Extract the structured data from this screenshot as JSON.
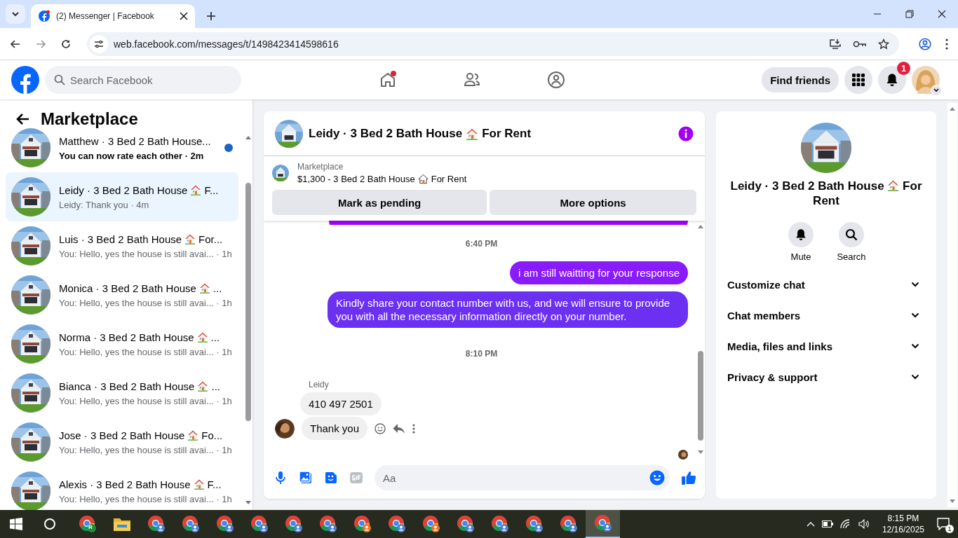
{
  "browser": {
    "tab_title": "(2) Messenger | Facebook",
    "url": "web.facebook.com/messages/t/1498423414598616"
  },
  "header": {
    "search_placeholder": "Search Facebook",
    "find_friends": "Find friends",
    "notification_count": "1"
  },
  "sidebar": {
    "title": "Marketplace",
    "conversations": [
      {
        "title": "Matthew · 3 Bed 2 Bath House...",
        "preview": "You can now rate each other · 2m",
        "unread": true,
        "selected": false
      },
      {
        "title": "Leidy · 3 Bed 2 Bath House",
        "title_end": "F...",
        "preview": "Leidy: Thank you · 4m",
        "unread": false,
        "selected": true
      },
      {
        "title": "Luis · 3 Bed 2 Bath House",
        "title_end": "For...",
        "preview": "You: Hello, yes the house is still avai... · 1h",
        "unread": false,
        "selected": false
      },
      {
        "title": "Monica · 3 Bed 2 Bath House",
        "title_end": "...",
        "preview": "You: Hello, yes the house is still avai... · 1h",
        "unread": false,
        "selected": false
      },
      {
        "title": "Norma · 3 Bed 2 Bath House",
        "title_end": "...",
        "preview": "You: Hello, yes the house is still avai... · 1h",
        "unread": false,
        "selected": false
      },
      {
        "title": "Bianca · 3 Bed 2 Bath House",
        "title_end": "...",
        "preview": "You: Hello, yes the house is still avai... · 1h",
        "unread": false,
        "selected": false
      },
      {
        "title": "Jose · 3 Bed 2 Bath House",
        "title_end": "Fo...",
        "preview": "You: Hello, yes the house is still avai... · 1h",
        "unread": false,
        "selected": false
      },
      {
        "title": "Alexis · 3 Bed 2 Bath House",
        "title_end": "F...",
        "preview": "You: Hello, yes the house is still avai... · 1h",
        "unread": false,
        "selected": false
      }
    ]
  },
  "chat": {
    "title": "Leidy · 3 Bed 2 Bath House",
    "title_end": "For Rent",
    "listing": {
      "label": "Marketplace",
      "title": "$1,300 - 3 Bed 2 Bath House",
      "title_end": "For Rent"
    },
    "actions": [
      "Mark as pending",
      "More options"
    ],
    "messages": [
      {
        "kind": "sent-cut"
      },
      {
        "kind": "time",
        "text": "6:40 PM"
      },
      {
        "kind": "sent",
        "text": "i am still waitting for your response"
      },
      {
        "kind": "sent",
        "text": "Kindly share your contact number with us, and we will ensure to provide you with all the necessary information directly on your number."
      },
      {
        "kind": "time",
        "text": "8:10 PM"
      },
      {
        "kind": "sender",
        "text": "Leidy"
      },
      {
        "kind": "received",
        "text": "410 497 2501"
      },
      {
        "kind": "received-last",
        "text": "Thank you"
      },
      {
        "kind": "seen"
      }
    ],
    "composer_placeholder": "Aa"
  },
  "details": {
    "title": "Leidy · 3 Bed 2 Bath House",
    "title_end": "For Rent",
    "actions": [
      {
        "kind": "mute",
        "label": "Mute"
      },
      {
        "kind": "search",
        "label": "Search"
      }
    ],
    "sections": [
      "Customize chat",
      "Chat members",
      "Media, files and links",
      "Privacy & support"
    ]
  },
  "taskbar": {
    "apps": [
      {
        "kind": "chrome",
        "badge": "R",
        "color": "#1e8e3e",
        "active": false
      },
      {
        "kind": "folder",
        "active": false
      },
      {
        "kind": "chrome",
        "color": "#4a7fd6",
        "active": false
      },
      {
        "kind": "chrome",
        "color": "#4a7fd6",
        "active": false
      },
      {
        "kind": "chrome",
        "color": "#4a7fd6",
        "active": false
      },
      {
        "kind": "chrome",
        "color": "#4a7fd6",
        "active": false
      },
      {
        "kind": "chrome",
        "color": "#4a7fd6",
        "active": false
      },
      {
        "kind": "chrome",
        "color": "#4a7fd6",
        "active": false
      },
      {
        "kind": "chrome",
        "color": "#e8761f",
        "active": false
      },
      {
        "kind": "chrome",
        "color": "#4a7fd6",
        "active": false
      },
      {
        "kind": "chrome",
        "color": "#e8761f",
        "active": false
      },
      {
        "kind": "chrome",
        "color": "#4a7fd6",
        "active": false
      },
      {
        "kind": "chrome",
        "color": "#4a7fd6",
        "active": false
      },
      {
        "kind": "chrome",
        "color": "#4a7fd6",
        "active": false
      },
      {
        "kind": "chrome",
        "color": "#4a7fd6",
        "active": false
      },
      {
        "kind": "chrome",
        "color": "#4a7fd6",
        "active": true
      }
    ],
    "time": "8:15 PM",
    "date": "12/16/2025",
    "notifications": "1"
  }
}
